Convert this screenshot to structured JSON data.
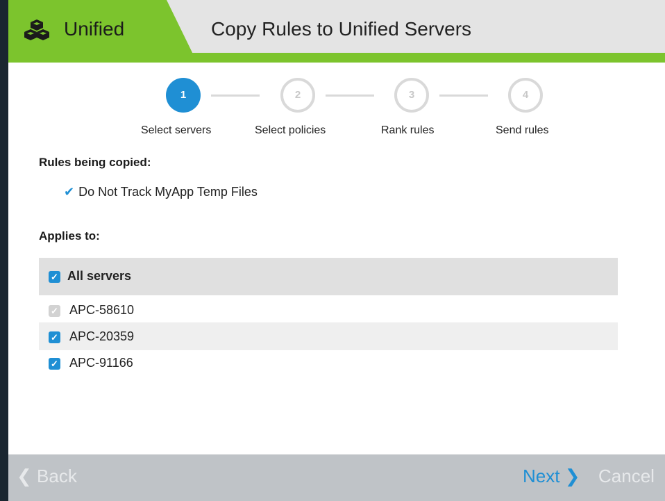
{
  "header": {
    "brand": "Unified",
    "brand_icon": "boxes-icon",
    "title": "Copy Rules to Unified Servers",
    "accent_color": "#7cc42d"
  },
  "steps": [
    {
      "number": "1",
      "label": "Select servers",
      "state": "active"
    },
    {
      "number": "2",
      "label": "Select policies",
      "state": "inactive"
    },
    {
      "number": "3",
      "label": "Rank rules",
      "state": "inactive"
    },
    {
      "number": "4",
      "label": "Send rules",
      "state": "inactive"
    }
  ],
  "rules_section": {
    "heading": "Rules being copied:",
    "items": [
      "Do Not Track MyApp Temp Files"
    ]
  },
  "applies_section": {
    "heading": "Applies to:",
    "all_label": "All servers",
    "all_checked": true,
    "servers": [
      {
        "name": "APC-58610",
        "checked": true,
        "disabled": true
      },
      {
        "name": "APC-20359",
        "checked": true,
        "disabled": false
      },
      {
        "name": "APC-91166",
        "checked": true,
        "disabled": false
      }
    ]
  },
  "footer": {
    "back": "Back",
    "next": "Next",
    "cancel": "Cancel"
  },
  "colors": {
    "primary": "#1f8fd4",
    "footer_bg": "#bfc3c7"
  }
}
